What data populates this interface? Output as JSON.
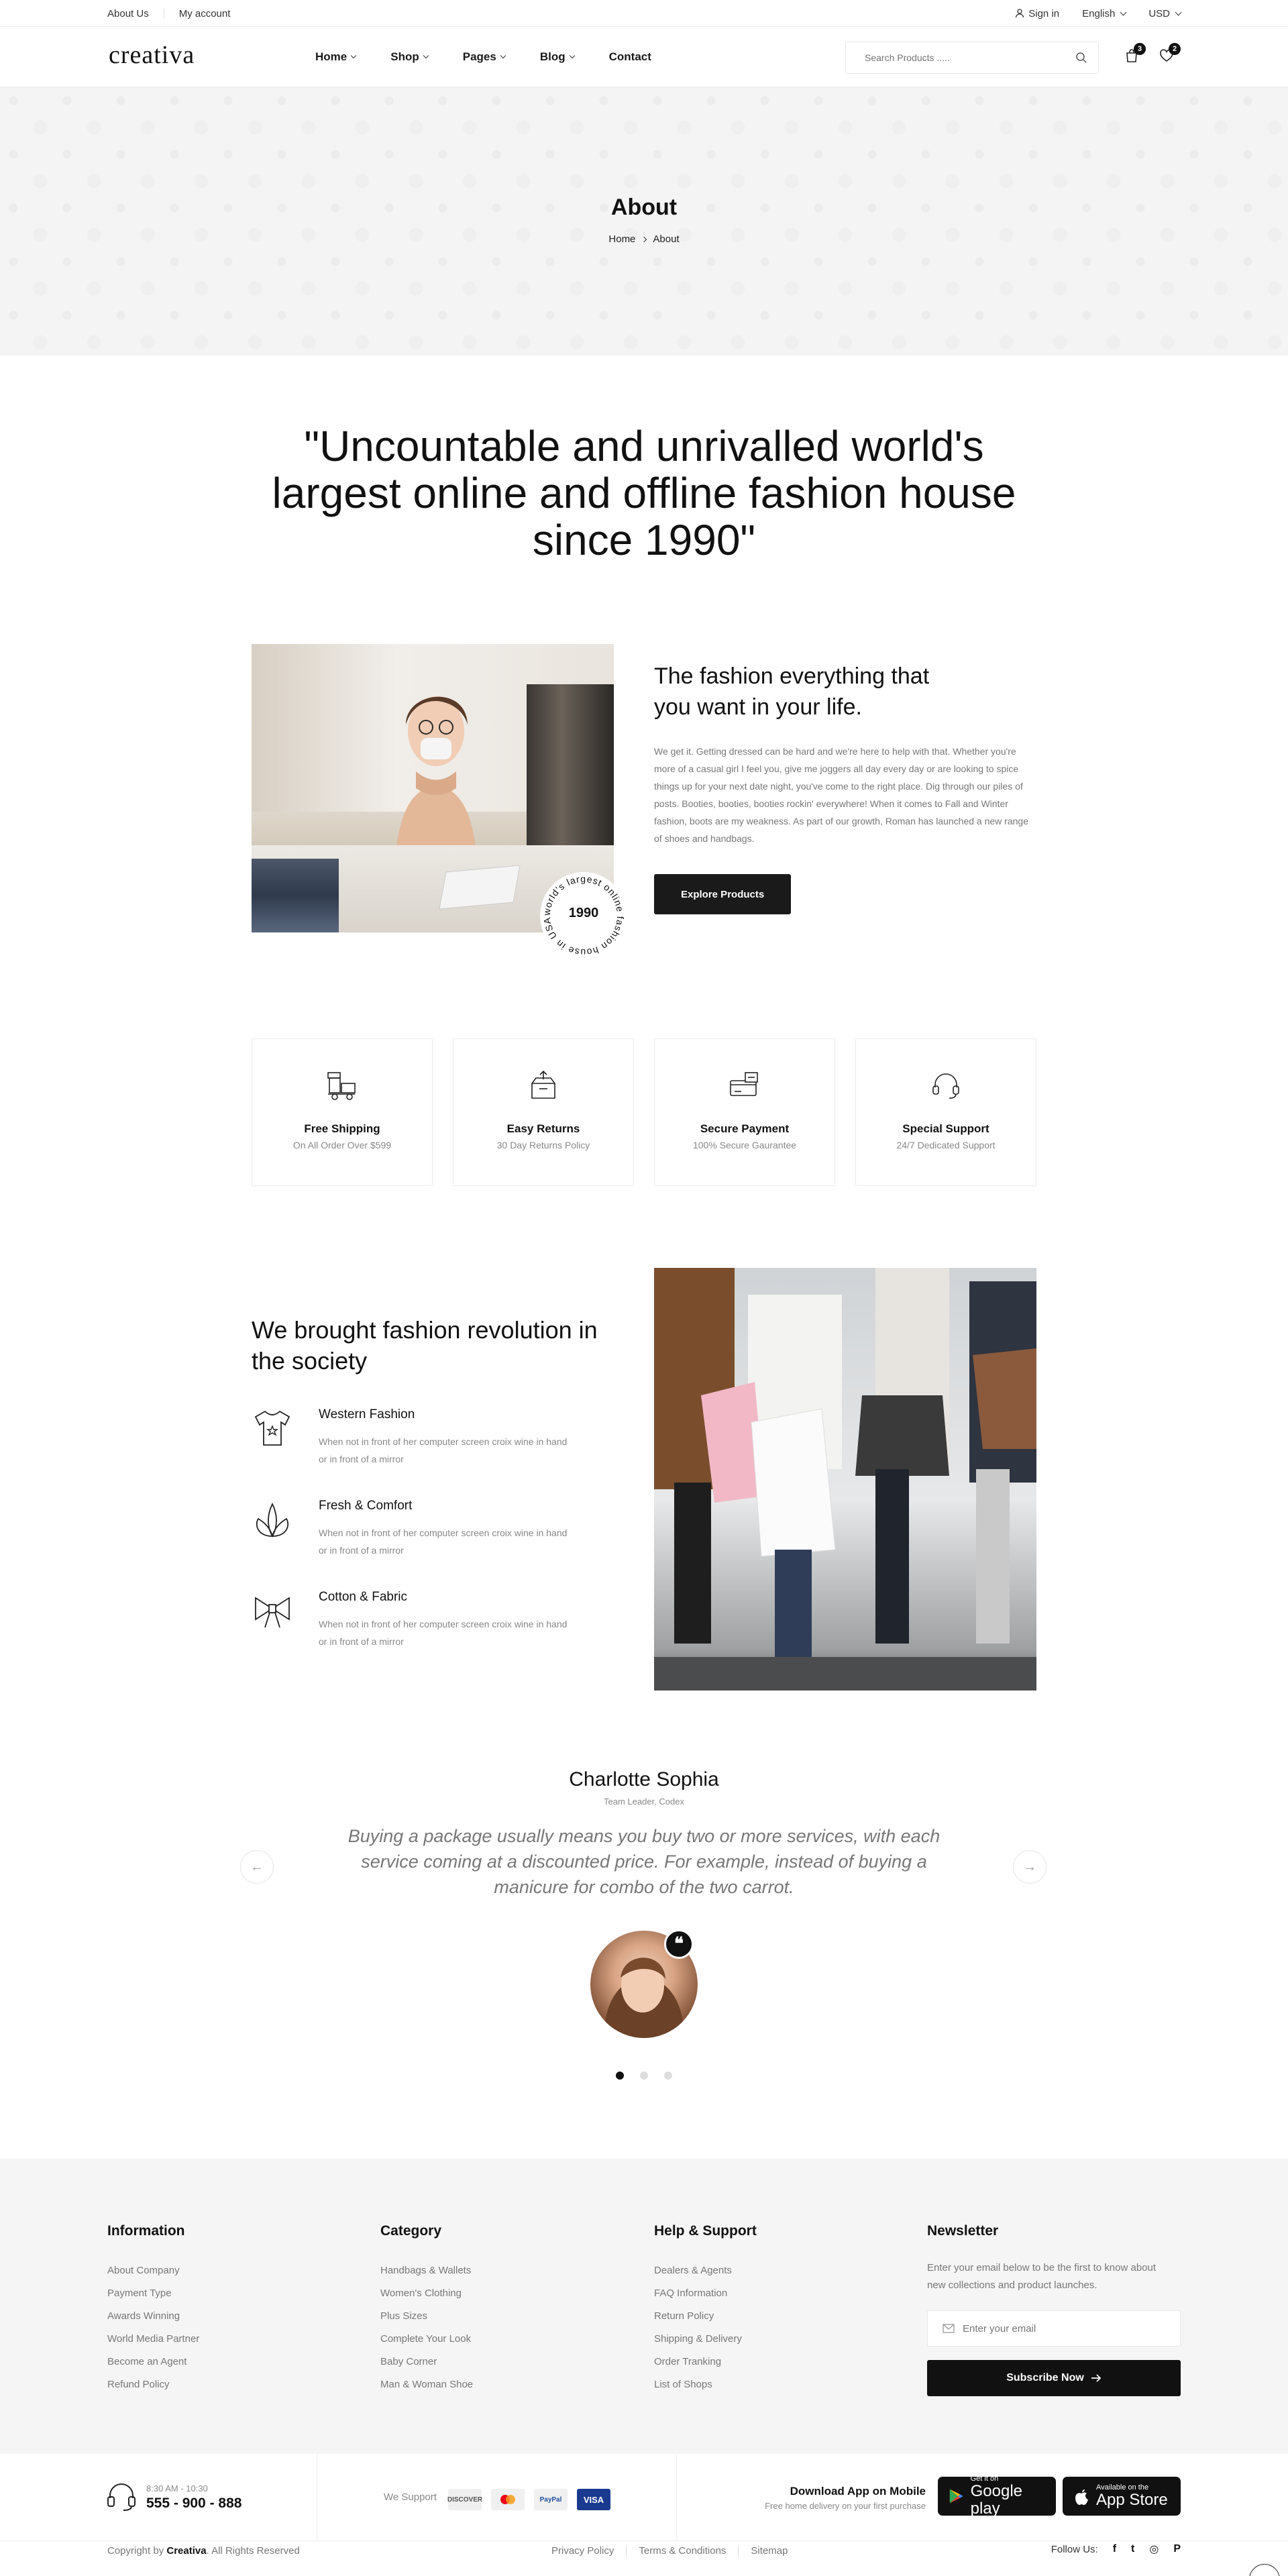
{
  "topbar": {
    "about": "About Us",
    "account": "My account",
    "signin": "Sign in",
    "language": "English",
    "currency": "USD"
  },
  "header": {
    "logo": "creativa",
    "nav": [
      {
        "label": "Home",
        "has_menu": true
      },
      {
        "label": "Shop",
        "has_menu": true
      },
      {
        "label": "Pages",
        "has_menu": true
      },
      {
        "label": "Blog",
        "has_menu": true
      },
      {
        "label": "Contact",
        "has_menu": false
      }
    ],
    "search_placeholder": "Search Products .....",
    "cart_count": "3",
    "wishlist_count": "2"
  },
  "banner": {
    "title": "About",
    "crumb_home": "Home",
    "crumb_current": "About"
  },
  "quote": "\"Uncountable and unrivalled world's largest online and offline fashion house since 1990\"",
  "about": {
    "heading": "The fashion everything that you want in your life.",
    "body": "We get it. Getting dressed can be hard and we're here to help with that. Whether you're more of a casual girl I feel you, give me joggers all day every day or are looking to spice things up for your next date night, you've come to the right place. Dig through our piles of posts. Booties, booties, booties rockin' everywhere! When it comes to Fall and Winter fashion, boots are my weakness. As part of our growth, Roman has launched a new range of shoes and handbags.",
    "button": "Explore Products",
    "stamp_year": "1990",
    "stamp_ring": "world's largest online fashion house in USA"
  },
  "features": [
    {
      "icon": "shipping-icon",
      "title": "Free Shipping",
      "sub": "On All Order Over $599"
    },
    {
      "icon": "returns-icon",
      "title": "Easy Returns",
      "sub": "30 Day Returns Policy"
    },
    {
      "icon": "payment-icon",
      "title": "Secure Payment",
      "sub": "100% Secure Gaurantee"
    },
    {
      "icon": "headset-icon",
      "title": "Special Support",
      "sub": "24/7 Dedicated Support"
    }
  ],
  "revolution": {
    "heading": "We brought fashion revolution in the society",
    "items": [
      {
        "icon": "tshirt-icon",
        "title": "Western Fashion",
        "desc": "When not in front of her computer screen croix wine in hand or in front of a mirror"
      },
      {
        "icon": "leaf-icon",
        "title": "Fresh & Comfort",
        "desc": "When not in front of her computer screen croix wine in hand or in front of a mirror"
      },
      {
        "icon": "bow-icon",
        "title": "Cotton & Fabric",
        "desc": "When not in front of her computer screen croix wine in hand or in front of a mirror"
      }
    ]
  },
  "testimonial": {
    "name": "Charlotte Sophia",
    "role": "Team Leader, Codex",
    "text": "Buying a package usually means you buy two or more services, with each service coming at a discounted price. For example, instead of buying a manicure for combo of the two carrot.",
    "prev": "←",
    "next": "→",
    "quote_mark": "❝",
    "active_slide": 1,
    "slide_count": 3
  },
  "footer": {
    "columns": [
      {
        "title": "Information",
        "links": [
          "About Company",
          "Payment Type",
          "Awards Winning",
          "World Media Partner",
          "Become an Agent",
          "Refund Policy"
        ]
      },
      {
        "title": "Category",
        "links": [
          "Handbags & Wallets",
          "Women's Clothing",
          "Plus Sizes",
          "Complete Your Look",
          "Baby Corner",
          "Man & Woman Shoe"
        ]
      },
      {
        "title": "Help & Support",
        "links": [
          "Dealers & Agents",
          "FAQ Information",
          "Return Policy",
          "Shipping & Delivery",
          "Order Tranking",
          "List of Shops"
        ]
      }
    ],
    "newsletter": {
      "title": "Newsletter",
      "desc": "Enter your email below to be the first to know about new collections and product launches.",
      "placeholder": "Enter your email",
      "button": "Subscribe Now"
    },
    "hours": "8:30 AM - 10:30",
    "phone": "555 - 900 - 888",
    "support_label": "We Support",
    "payments": [
      "DISCOVER",
      "Mastercard",
      "PayPal",
      "VISA"
    ],
    "download_title": "Download App on Mobile",
    "download_sub": "Free home delivery on your first purchase",
    "google": {
      "small": "Get it on",
      "big": "Google play"
    },
    "apple": {
      "small": "Available on the",
      "big": "App Store"
    },
    "copyright_pre": "Copyright by",
    "copyright_brand": "Creativa",
    "copyright_post": ". All Rights Reserved",
    "legal": [
      "Privacy Policy",
      "Terms & Conditions",
      "Sitemap"
    ],
    "follow": "Follow Us:",
    "social": [
      "f",
      "t",
      "◎",
      "P"
    ]
  }
}
